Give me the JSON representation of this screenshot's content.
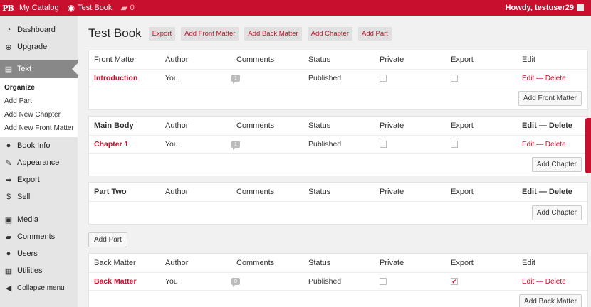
{
  "adminbar": {
    "logo": "PB",
    "my_catalog": "My Catalog",
    "book_title": "Test Book",
    "comments_count": "0",
    "howdy": "Howdy, testuser29"
  },
  "sidebar": {
    "items_top": [
      {
        "label": "Dashboard",
        "icon": "dashboard-icon",
        "glyph": "◔"
      },
      {
        "label": "Upgrade",
        "icon": "upgrade-icon",
        "glyph": "⊕"
      }
    ],
    "current": {
      "label": "Text",
      "icon": "book-icon",
      "glyph": "▤"
    },
    "submenu": [
      "Organize",
      "Add Part",
      "Add New Chapter",
      "Add New Front Matter"
    ],
    "items_mid": [
      {
        "label": "Book Info",
        "icon": "info-icon",
        "glyph": "●"
      },
      {
        "label": "Appearance",
        "icon": "paintbrush-icon",
        "glyph": "✎"
      },
      {
        "label": "Export",
        "icon": "export-icon",
        "glyph": "➦"
      },
      {
        "label": "Sell",
        "icon": "dollar-icon",
        "glyph": "$"
      }
    ],
    "items_bottom": [
      {
        "label": "Media",
        "icon": "media-icon",
        "glyph": "▣"
      },
      {
        "label": "Comments",
        "icon": "comment-icon",
        "glyph": "▰"
      },
      {
        "label": "Users",
        "icon": "users-icon",
        "glyph": "●"
      },
      {
        "label": "Utilities",
        "icon": "utilities-icon",
        "glyph": "▦"
      },
      {
        "label": "Collapse menu",
        "icon": "collapse-icon",
        "glyph": "◀"
      }
    ]
  },
  "main": {
    "title": "Test Book",
    "title_buttons": [
      "Export",
      "Add Front Matter",
      "Add Back Matter",
      "Add Chapter",
      "Add Part"
    ],
    "columns": [
      "Author",
      "Comments",
      "Status",
      "Private",
      "Export",
      "Edit"
    ],
    "front_matter": {
      "heading": "Front Matter",
      "rows": [
        {
          "title": "Introduction",
          "author": "You",
          "comments": "1",
          "status": "Published",
          "private": false,
          "export": false
        }
      ],
      "add_button": "Add Front Matter"
    },
    "main_body": {
      "heading": "Main Body",
      "rows": [
        {
          "title": "Chapter 1",
          "author": "You",
          "comments": "1",
          "status": "Published",
          "private": false,
          "export": false
        }
      ],
      "add_button": "Add Chapter"
    },
    "part_two": {
      "heading": "Part Two",
      "add_button": "Add Chapter"
    },
    "add_part_button": "Add Part",
    "back_matter": {
      "heading": "Back Matter",
      "rows": [
        {
          "title": "Back Matter",
          "author": "You",
          "comments": "0",
          "status": "Published",
          "private": false,
          "export": true
        }
      ],
      "add_button": "Add Back Matter"
    },
    "edit_label": "Edit",
    "sep": "—",
    "delete_label": "Delete"
  },
  "colors": {
    "brand": "#c8102e",
    "sidebar_bg": "#e5e5e5",
    "current_bg": "#888888"
  }
}
